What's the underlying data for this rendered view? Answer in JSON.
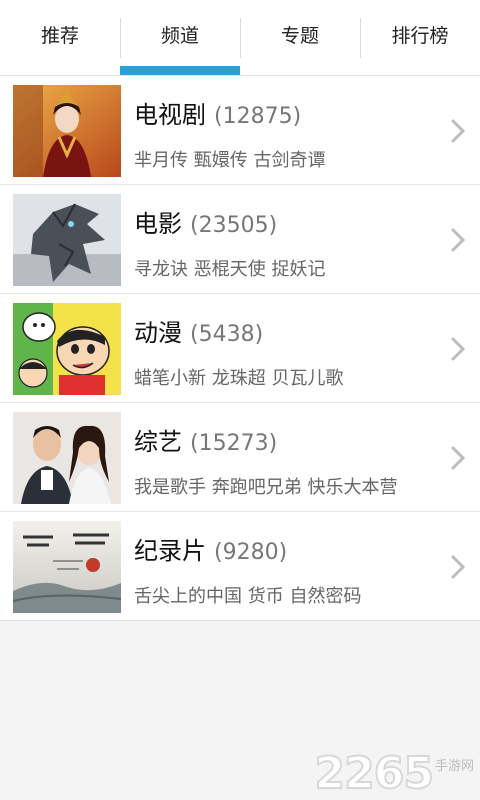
{
  "tabs": [
    {
      "label": "推荐",
      "active": false
    },
    {
      "label": "频道",
      "active": true
    },
    {
      "label": "专题",
      "active": false
    },
    {
      "label": "排行榜",
      "active": false
    }
  ],
  "accent_color": "#2a9ddb",
  "channels": [
    {
      "name": "电视剧",
      "count": "(12875)",
      "shows": "芈月传 甄嬛传 古剑奇谭",
      "thumb_icon": "tv-drama-thumbnail"
    },
    {
      "name": "电影",
      "count": "(23505)",
      "shows": "寻龙诀 恶棍天使 捉妖记",
      "thumb_icon": "movie-thumbnail"
    },
    {
      "name": "动漫",
      "count": "(5438)",
      "shows": "蜡笔小新 龙珠超 贝瓦儿歌",
      "thumb_icon": "anime-thumbnail"
    },
    {
      "name": "综艺",
      "count": "(15273)",
      "shows": "我是歌手 奔跑吧兄弟 快乐大本营",
      "thumb_icon": "variety-thumbnail"
    },
    {
      "name": "纪录片",
      "count": "(9280)",
      "shows": "舌尖上的中国 货币 自然密码",
      "thumb_icon": "documentary-thumbnail"
    }
  ],
  "watermark": {
    "number": "2265",
    "text": "手游网"
  }
}
